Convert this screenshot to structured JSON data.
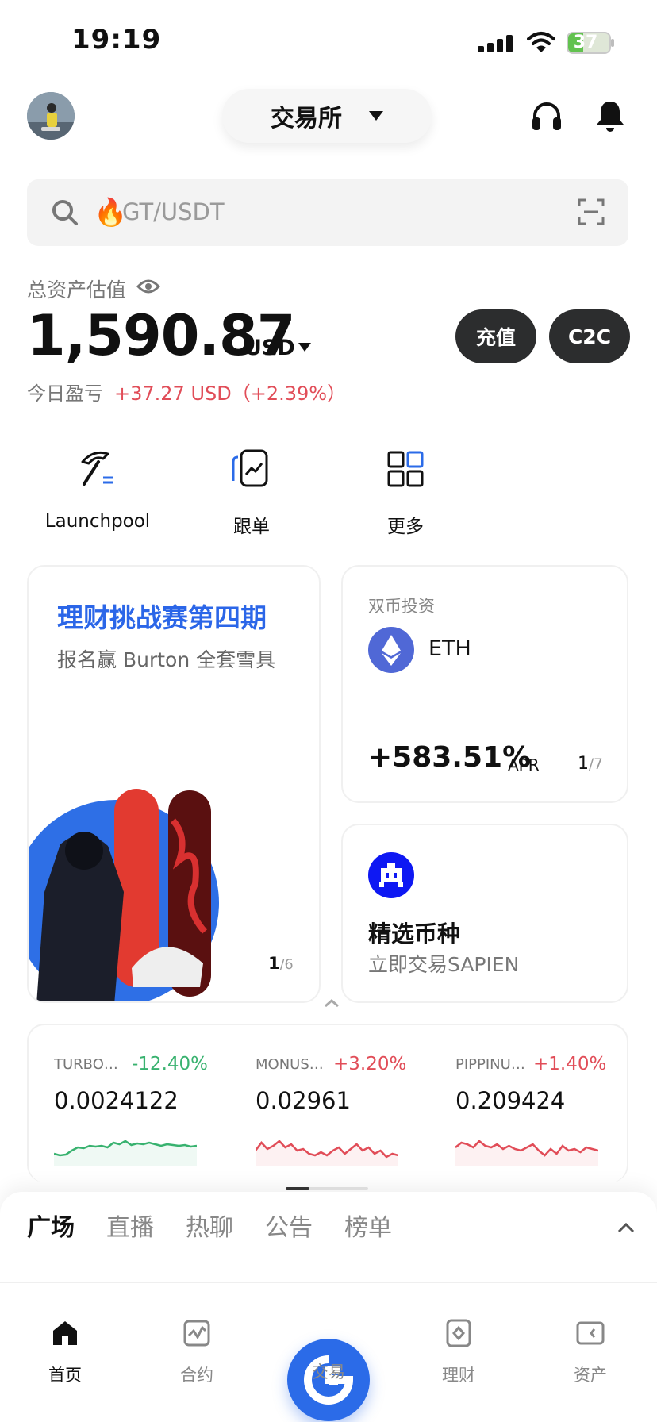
{
  "status_bar": {
    "time": "19:19",
    "battery": "37",
    "battery_level": 0.37
  },
  "header": {
    "exchange_label": "交易所",
    "icons": [
      "avatar",
      "headset-icon",
      "bell-icon"
    ]
  },
  "search": {
    "placeholder": "GT/USDT",
    "emoji": "🔥"
  },
  "assets": {
    "label": "总资产估值",
    "value": "1,590.87",
    "unit": "USD",
    "pnl_label": "今日盈亏",
    "pnl_value": "+37.27 USD（+2.39%）",
    "deposit_button": "充值",
    "c2c_button": "C2C",
    "pnl_color": "#e14d58"
  },
  "quick_actions": [
    {
      "label": "Launchpool",
      "icon": "pickaxe-icon"
    },
    {
      "label": "跟单",
      "icon": "copytrade-icon"
    },
    {
      "label": "更多",
      "icon": "grid-icon"
    }
  ],
  "promo_card": {
    "title": "理财挑战赛第四期",
    "subtitle": "报名赢 Burton 全套雪具",
    "page_current": "1",
    "page_total": "/6"
  },
  "dual_card": {
    "title": "双币投资",
    "coin": "ETH",
    "apr_value": "+583.51%",
    "apr_label": "APR",
    "page_current": "1",
    "page_total": "/7"
  },
  "select_card": {
    "title": "精选币种",
    "subtitle": "立即交易SAPIEN"
  },
  "tickers": [
    {
      "name": "TURBOU...",
      "change": "-12.40%",
      "price": "0.0024122",
      "color": "#38b26f"
    },
    {
      "name": "MONUSDT",
      "change": "+3.20%",
      "price": "0.02961",
      "color": "#e14d58"
    },
    {
      "name": "PIPPINUS...",
      "change": "+1.40%",
      "price": "0.209424",
      "color": "#e14d58"
    }
  ],
  "feed_tabs": [
    "广场",
    "直播",
    "热聊",
    "公告",
    "榜单"
  ],
  "feed_active_tab": "广场",
  "tabbar": [
    {
      "label": "首页",
      "icon": "home-icon",
      "active": true
    },
    {
      "label": "合约",
      "icon": "futures-icon",
      "active": false
    },
    {
      "label": "交易",
      "icon": "trade-icon",
      "active": false
    },
    {
      "label": "理财",
      "icon": "earn-icon",
      "active": false
    },
    {
      "label": "资产",
      "icon": "wallet-icon",
      "active": false
    }
  ],
  "colors": {
    "accent": "#2b6be8",
    "up": "#e14d58",
    "down": "#38b26f"
  }
}
